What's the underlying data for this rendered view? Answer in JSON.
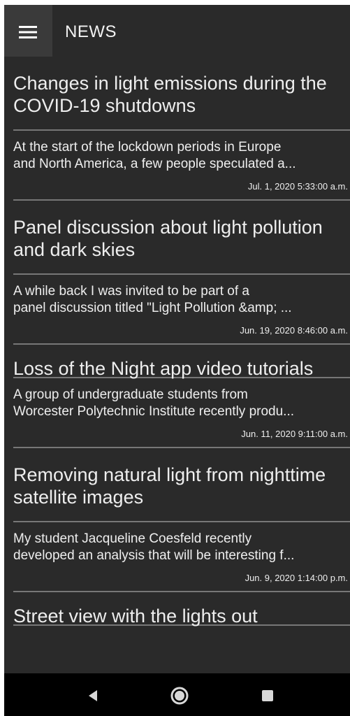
{
  "app_bar": {
    "menu_icon": "hamburger-menu-icon",
    "title": "NEWS"
  },
  "news": [
    {
      "title": "Changes in light emissions during the\nCOVID-19 shutdowns",
      "summary": "At the start of the lockdown periods in Europe\nand North America, a few people speculated a...",
      "date": "Jul. 1, 2020 5:33:00 a.m."
    },
    {
      "title": "Panel discussion about light pollution\nand dark skies",
      "summary": "A while back I was invited to be part of a\npanel discussion titled \"Light Pollution &amp; ...",
      "date": "Jun. 19, 2020 8:46:00 a.m."
    },
    {
      "title": "Loss of the Night app video tutorials",
      "summary": "A group of undergraduate students from\nWorcester Polytechnic Institute recently produ...",
      "date": "Jun. 11, 2020 9:11:00 a.m."
    },
    {
      "title": "Removing natural light from nighttime\nsatellite images",
      "summary": "My student Jacqueline Coesfeld recently\ndeveloped an analysis that will be interesting f...",
      "date": "Jun. 9, 2020 1:14:00 p.m."
    },
    {
      "title": "Street view with the lights out"
    }
  ],
  "system_nav": {
    "back_icon": "back-triangle-icon",
    "home_icon": "home-circle-icon",
    "recents_icon": "recent-apps-square-icon"
  },
  "colors": {
    "app_background": "#2a2a2a",
    "menu_button_background": "#3a3a3a",
    "text": "#eeeeee",
    "divider": "#777777",
    "navigation_bar": "#000000"
  }
}
